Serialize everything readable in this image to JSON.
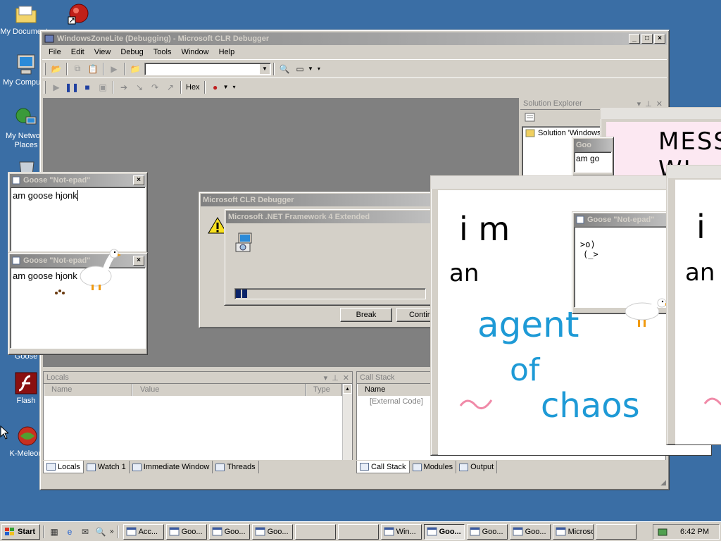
{
  "desktop": {
    "icons": [
      {
        "label": "My Documents",
        "icon": "folder-icon"
      },
      {
        "label": "My Computer",
        "icon": "computer-icon"
      },
      {
        "label": "My Network Places",
        "icon": "network-icon"
      },
      {
        "label": "Goose",
        "icon": "goose-app-icon"
      },
      {
        "label": "Flash",
        "icon": "flash-icon"
      },
      {
        "label": "K-Meleon",
        "icon": "kmeleon-icon"
      }
    ]
  },
  "debugger": {
    "title": "WindowsZoneLite (Debugging) - Microsoft CLR Debugger",
    "menu": [
      "File",
      "Edit",
      "View",
      "Debug",
      "Tools",
      "Window",
      "Help"
    ],
    "hex_label": "Hex",
    "solution_explorer": {
      "title": "Solution Explorer",
      "item": "Solution 'Windows"
    },
    "locals": {
      "title": "Locals",
      "columns": [
        "Name",
        "Value",
        "Type"
      ]
    },
    "callstack": {
      "title": "Call Stack",
      "column": "Name",
      "row": "[External Code]"
    },
    "bottom_tabs_left": [
      "Locals",
      "Watch 1",
      "Immediate Window",
      "Threads"
    ],
    "bottom_tabs_right": [
      "Call Stack",
      "Modules",
      "Output"
    ]
  },
  "clr_dialog": {
    "title": "Microsoft CLR Debugger",
    "buttons": [
      "Break",
      "Continu"
    ]
  },
  "net_dialog": {
    "title": "Microsoft .NET Framework 4 Extended",
    "progress": 0.07
  },
  "notepads": [
    {
      "title": "Goose \"Not-epad\"",
      "text": "am goose hjonk"
    },
    {
      "title": "Goose \"Not-epad\"",
      "text": "am goose hjonk"
    },
    {
      "title": "Goose \"Not-epad\"",
      "text_line1": ">o)",
      "text_line2": "(_>"
    },
    {
      "title": "Goo",
      "text": "am go"
    }
  ],
  "meme_windows": {
    "mess_text": "MESS WI",
    "drawing_lines": [
      "i m",
      "an",
      "agent",
      "of",
      "chaos"
    ],
    "right_lines": [
      "i",
      "an"
    ]
  },
  "taskbar": {
    "start": "Start",
    "items": [
      {
        "label": "Acc...",
        "pressed": false
      },
      {
        "label": "Goo...",
        "pressed": false
      },
      {
        "label": "Goo...",
        "pressed": false
      },
      {
        "label": "Goo...",
        "pressed": false
      },
      {
        "label": "",
        "pressed": false
      },
      {
        "label": "",
        "pressed": false
      },
      {
        "label": "Win...",
        "pressed": false
      },
      {
        "label": "Goo...",
        "pressed": true
      },
      {
        "label": "Goo...",
        "pressed": false
      },
      {
        "label": "Goo...",
        "pressed": false
      },
      {
        "label": "Microsof...",
        "pressed": false
      },
      {
        "label": "",
        "pressed": false
      }
    ],
    "clock": "6:42 PM"
  },
  "colors": {
    "desktop": "#3a6ea5",
    "title_active": "#0a246a",
    "marker_blue": "#1e9ad6",
    "marker_pink": "#f08aa8"
  }
}
